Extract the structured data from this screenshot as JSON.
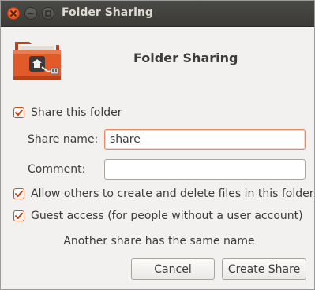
{
  "window": {
    "title": "Folder Sharing",
    "controls": {
      "close_icon": "close-icon",
      "minimize_icon": "minimize-icon",
      "maximize_icon": "maximize-icon"
    }
  },
  "header": {
    "icon": "folder-share-icon",
    "title": "Folder Sharing"
  },
  "share_folder": {
    "label": "Share this folder",
    "checked": true
  },
  "form": {
    "share_name_label": "Share name:",
    "share_name_value": "share",
    "comment_label": "Comment:",
    "comment_value": ""
  },
  "options": {
    "allow_others_label": "Allow others to create and delete files in this folder",
    "allow_others_checked": true,
    "guest_access_label": "Guest access (for people without a user account)",
    "guest_access_checked": true
  },
  "status": {
    "message": "Another share has the same name"
  },
  "buttons": {
    "cancel_label": "Cancel",
    "create_label": "Create Share"
  },
  "colors": {
    "accent": "#dd4814",
    "checkbox_mark": "#c34113",
    "titlebar": "#3c3b37",
    "focus_border": "#e28a6a"
  }
}
